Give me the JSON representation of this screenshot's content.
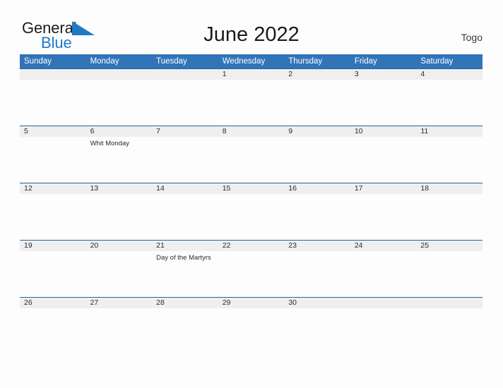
{
  "brand": {
    "name_part1": "General",
    "name_part2": "Blue",
    "flag_icon": "blue-triangle-flag-icon",
    "accent_color": "#1f7ac4"
  },
  "header": {
    "title": "June 2022",
    "country": "Togo"
  },
  "theme": {
    "header_blue": "#3174b8",
    "row_line_blue": "#2a6096",
    "date_band_gray": "#efefef",
    "page_background": "#fdfdfd",
    "text_color": "#2b2b2b"
  },
  "calendar": {
    "weekdays": [
      "Sunday",
      "Monday",
      "Tuesday",
      "Wednesday",
      "Thursday",
      "Friday",
      "Saturday"
    ],
    "weeks": [
      {
        "days": [
          {
            "date": "",
            "events": []
          },
          {
            "date": "",
            "events": []
          },
          {
            "date": "",
            "events": []
          },
          {
            "date": "1",
            "events": []
          },
          {
            "date": "2",
            "events": []
          },
          {
            "date": "3",
            "events": []
          },
          {
            "date": "4",
            "events": []
          }
        ]
      },
      {
        "days": [
          {
            "date": "5",
            "events": []
          },
          {
            "date": "6",
            "events": [
              "Whit Monday"
            ]
          },
          {
            "date": "7",
            "events": []
          },
          {
            "date": "8",
            "events": []
          },
          {
            "date": "9",
            "events": []
          },
          {
            "date": "10",
            "events": []
          },
          {
            "date": "11",
            "events": []
          }
        ]
      },
      {
        "days": [
          {
            "date": "12",
            "events": []
          },
          {
            "date": "13",
            "events": []
          },
          {
            "date": "14",
            "events": []
          },
          {
            "date": "15",
            "events": []
          },
          {
            "date": "16",
            "events": []
          },
          {
            "date": "17",
            "events": []
          },
          {
            "date": "18",
            "events": []
          }
        ]
      },
      {
        "days": [
          {
            "date": "19",
            "events": []
          },
          {
            "date": "20",
            "events": []
          },
          {
            "date": "21",
            "events": [
              "Day of the Martyrs"
            ]
          },
          {
            "date": "22",
            "events": []
          },
          {
            "date": "23",
            "events": []
          },
          {
            "date": "24",
            "events": []
          },
          {
            "date": "25",
            "events": []
          }
        ]
      },
      {
        "days": [
          {
            "date": "26",
            "events": []
          },
          {
            "date": "27",
            "events": []
          },
          {
            "date": "28",
            "events": []
          },
          {
            "date": "29",
            "events": []
          },
          {
            "date": "30",
            "events": []
          },
          {
            "date": "",
            "events": []
          },
          {
            "date": "",
            "events": []
          }
        ]
      }
    ]
  }
}
